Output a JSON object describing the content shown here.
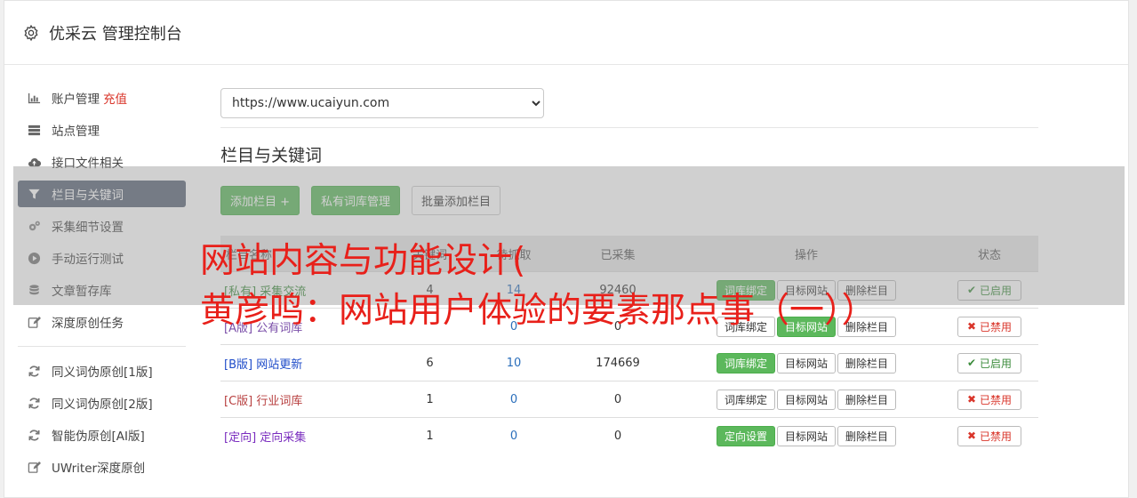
{
  "header": {
    "title": "优采云 管理控制台",
    "icon": "gear-icon"
  },
  "sidebar": {
    "items": [
      {
        "label": "账户管理",
        "extra": "充值",
        "icon": "bar-chart-icon"
      },
      {
        "label": "站点管理",
        "icon": "server-icon"
      },
      {
        "label": "接口文件相关",
        "icon": "cloud-upload-icon"
      },
      {
        "label": "栏目与关键词",
        "icon": "filter-icon",
        "active": true
      },
      {
        "label": "采集细节设置",
        "icon": "cogs-icon"
      },
      {
        "label": "手动运行测试",
        "icon": "play-circle-icon"
      },
      {
        "label": "文章暂存库",
        "icon": "database-icon"
      },
      {
        "label": "深度原创任务",
        "icon": "edit-icon"
      }
    ],
    "items2": [
      {
        "label": "同义词伪原创[1版]",
        "icon": "refresh-icon"
      },
      {
        "label": "同义词伪原创[2版]",
        "icon": "refresh-icon"
      },
      {
        "label": "智能伪原创[AI版]",
        "icon": "refresh-icon"
      },
      {
        "label": "UWriter深度原创",
        "icon": "edit-icon"
      }
    ]
  },
  "main": {
    "site_select": "https://www.ucaiyun.com",
    "section_title": "栏目与关键词",
    "buttons": {
      "add": "添加栏目 +",
      "private": "私有词库管理",
      "batch": "批量添加栏目"
    },
    "table": {
      "headers": [
        "栏目名称",
        "关键词",
        "待抓取",
        "已采集",
        "操作",
        "状态"
      ],
      "rows": [
        {
          "tag": "[私有]",
          "name": "采集交流",
          "kw": "4",
          "pending": "14",
          "collected": "92460",
          "op1": "词库绑定",
          "op1_green": true,
          "op2": "目标网站",
          "op2_green": false,
          "op3": "删除栏目",
          "status": "已启用",
          "on": true,
          "cls": "c-private"
        },
        {
          "tag": "[A版]",
          "name": "公有词库",
          "kw": "",
          "pending": "0",
          "collected": "0",
          "op1": "词库绑定",
          "op1_green": false,
          "op2": "目标网站",
          "op2_green": true,
          "op3": "删除栏目",
          "status": "已禁用",
          "on": false,
          "cls": "c-A"
        },
        {
          "tag": "[B版]",
          "name": "网站更新",
          "kw": "6",
          "pending": "10",
          "collected": "174669",
          "op1": "词库绑定",
          "op1_green": true,
          "op2": "目标网站",
          "op2_green": false,
          "op3": "删除栏目",
          "status": "已启用",
          "on": true,
          "cls": "c-B"
        },
        {
          "tag": "[C版]",
          "name": "行业词库",
          "kw": "1",
          "pending": "0",
          "collected": "0",
          "op1": "词库绑定",
          "op1_green": false,
          "op2": "目标网站",
          "op2_green": false,
          "op3": "删除栏目",
          "status": "已禁用",
          "on": false,
          "cls": "c-C"
        },
        {
          "tag": "[定向]",
          "name": "定向采集",
          "kw": "1",
          "pending": "0",
          "collected": "0",
          "op1": "定向设置",
          "op1_green": true,
          "op2": "目标网站",
          "op2_green": false,
          "op3": "删除栏目",
          "status": "已禁用",
          "on": false,
          "cls": "c-D"
        }
      ]
    }
  },
  "overlay": {
    "line1": "网站内容与功能设计(",
    "line2": "黄彦鸣：网站用户体验的要素那点事（一））"
  },
  "colors": {
    "accent_green": "#5cb85c",
    "active_nav": "#5a6577",
    "overlay_text": "#e8201a"
  }
}
